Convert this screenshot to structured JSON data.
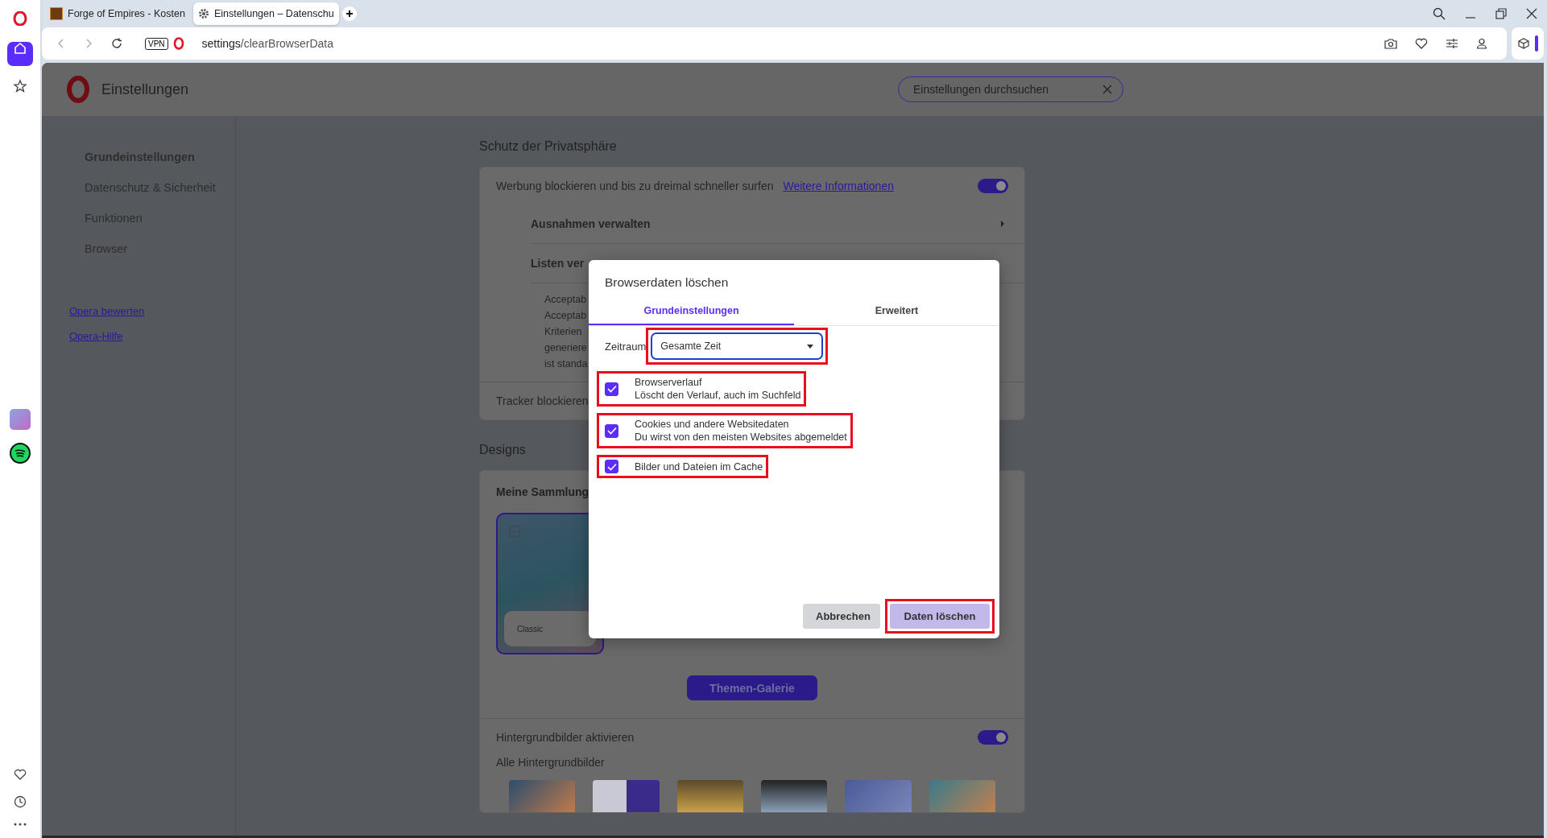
{
  "browser": {
    "tabs": [
      {
        "title": "Forge of Empires - Kosten",
        "selected": false
      },
      {
        "title": "Einstellungen – Datenschu",
        "selected": true
      }
    ],
    "address_bar": {
      "vpn_badge": "VPN",
      "url_host": "settings",
      "url_path": "/clearBrowserData"
    }
  },
  "settings": {
    "title": "Einstellungen",
    "search": {
      "placeholder": "Einstellungen durchsuchen"
    },
    "nav": [
      {
        "label": "Grundeinstellungen",
        "selected": true
      },
      {
        "label": "Datenschutz & Sicherheit",
        "selected": false
      },
      {
        "label": "Funktionen",
        "selected": false
      },
      {
        "label": "Browser",
        "selected": false
      }
    ],
    "links": [
      "Opera bewerten",
      "Opera-Hilfe"
    ],
    "privacy": {
      "heading": "Schutz der Privatsphäre",
      "adblock_text": "Werbung blockieren und bis zu dreimal schneller surfen",
      "adblock_link": "Weitere Informationen",
      "adblock_on": true,
      "subrows": [
        "Ausnahmen verwalten",
        "Listen ver"
      ],
      "acceptable_lines": [
        "Acceptab",
        "Acceptab",
        "Kriterien",
        "generiere",
        "ist standa"
      ],
      "tracker_label": "Tracker blockieren"
    },
    "designs": {
      "heading": "Designs",
      "collection_title": "Meine Sammlung",
      "themes": [
        {
          "name": "Classic",
          "selected": true
        }
      ],
      "gallery_button": "Themen-Galerie",
      "wallpapers_label": "Hintergrundbilder aktivieren",
      "wallpapers_on": true,
      "all_wallpapers": "Alle Hintergrundbilder"
    }
  },
  "dialog": {
    "title": "Browserdaten löschen",
    "tabs": [
      {
        "label": "Grundeinstellungen",
        "selected": true
      },
      {
        "label": "Erweitert",
        "selected": false
      }
    ],
    "time_range": {
      "label": "Zeitraum",
      "value": "Gesamte Zeit",
      "highlighted": true
    },
    "options": [
      {
        "title": "Browserverlauf",
        "description": "Löscht den Verlauf, auch im Suchfeld",
        "checked": true,
        "highlighted": true
      },
      {
        "title": "Cookies und andere Websitedaten",
        "description": "Du wirst von den meisten Websites abgemeldet",
        "checked": true,
        "highlighted": true
      },
      {
        "title": "Bilder und Dateien im Cache",
        "checked": true,
        "highlighted": true
      }
    ],
    "buttons": [
      {
        "label": "Abbrechen",
        "kind": "secondary",
        "highlighted": false
      },
      {
        "label": "Daten löschen",
        "kind": "primary",
        "highlighted": true
      }
    ]
  }
}
